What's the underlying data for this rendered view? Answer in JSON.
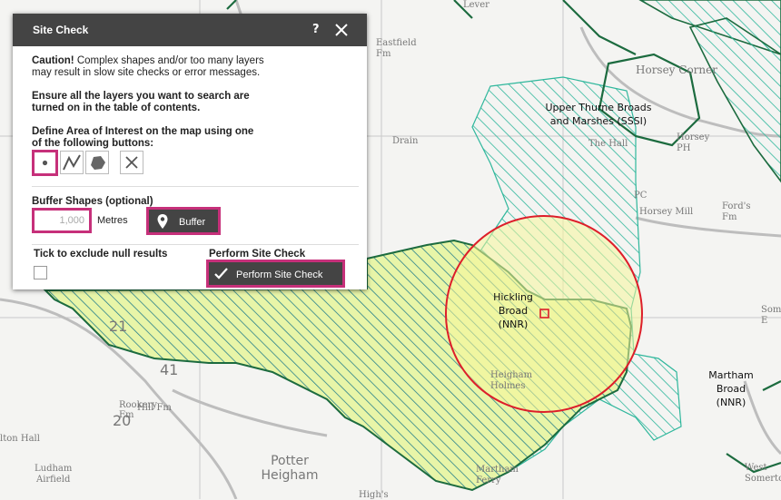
{
  "map": {
    "labels": {
      "upper_thurne": [
        "Upper Thurne Broads",
        "and Marshes (SSSI)"
      ],
      "hickling": [
        "Hickling",
        "Broad",
        "(NNR)"
      ],
      "martham": [
        "Martham",
        "Broad",
        "(NNR)"
      ],
      "potter": [
        "Potter",
        "Heigham"
      ],
      "ludham": [
        "Ludham",
        "Airfield"
      ]
    },
    "places": {
      "eastfield": [
        "Eastfield",
        "Fm"
      ],
      "horsey_corner": "Horsey Corner",
      "the_hall": "The Hall",
      "horsey_ph": [
        "Horsey",
        "PH"
      ],
      "horsey_mill": "Horsey Mill",
      "fords": [
        "Ford's",
        "Fm"
      ],
      "pc": "PC",
      "hill_fm": "Hill Fm",
      "rookery": [
        "Rookery",
        "Fm"
      ],
      "alton_hall": "lton Hall",
      "heigham_holmes": [
        "Heigham",
        "Holmes"
      ],
      "martham_ferry": [
        "Martham",
        "Ferry"
      ],
      "highs": "High's",
      "west_somerton": [
        "West",
        "Somerton"
      ],
      "somerton_edge": [
        "Som",
        "E"
      ],
      "num_21": "21",
      "num_20": "20",
      "num_41": "41",
      "drain": "Drain",
      "lever": "Lever"
    },
    "buffer_colors": {
      "outline": "#dd1e2a",
      "fill": "#f5f59a"
    },
    "layer_colors": {
      "sssi": "#2fb79c",
      "nnr": "#a5d22a",
      "boundary": "#1c6b3f"
    }
  },
  "dialog": {
    "title": "Site Check",
    "help": "?",
    "caution_bold": "Caution!",
    "caution_line1": " Complex shapes and/or too many layers",
    "caution_line2": "may result in slow site checks or error messages.",
    "ensure_line1": "Ensure all the layers you want to search are",
    "ensure_line2": "turned on in the table of contents.",
    "define_line1": "Define Area of Interest on the map using one",
    "define_line2": "of the following buttons:",
    "tools": [
      "point-tool",
      "line-tool",
      "polygon-tool",
      "clear-tool"
    ],
    "buffer_heading": "Buffer Shapes (optional)",
    "buffer_value": "1,000",
    "metres": "Metres",
    "buffer_button": "Buffer",
    "null_label": "Tick to exclude null results",
    "perform_heading": "Perform Site Check",
    "perform_button": "Perform Site Check"
  }
}
